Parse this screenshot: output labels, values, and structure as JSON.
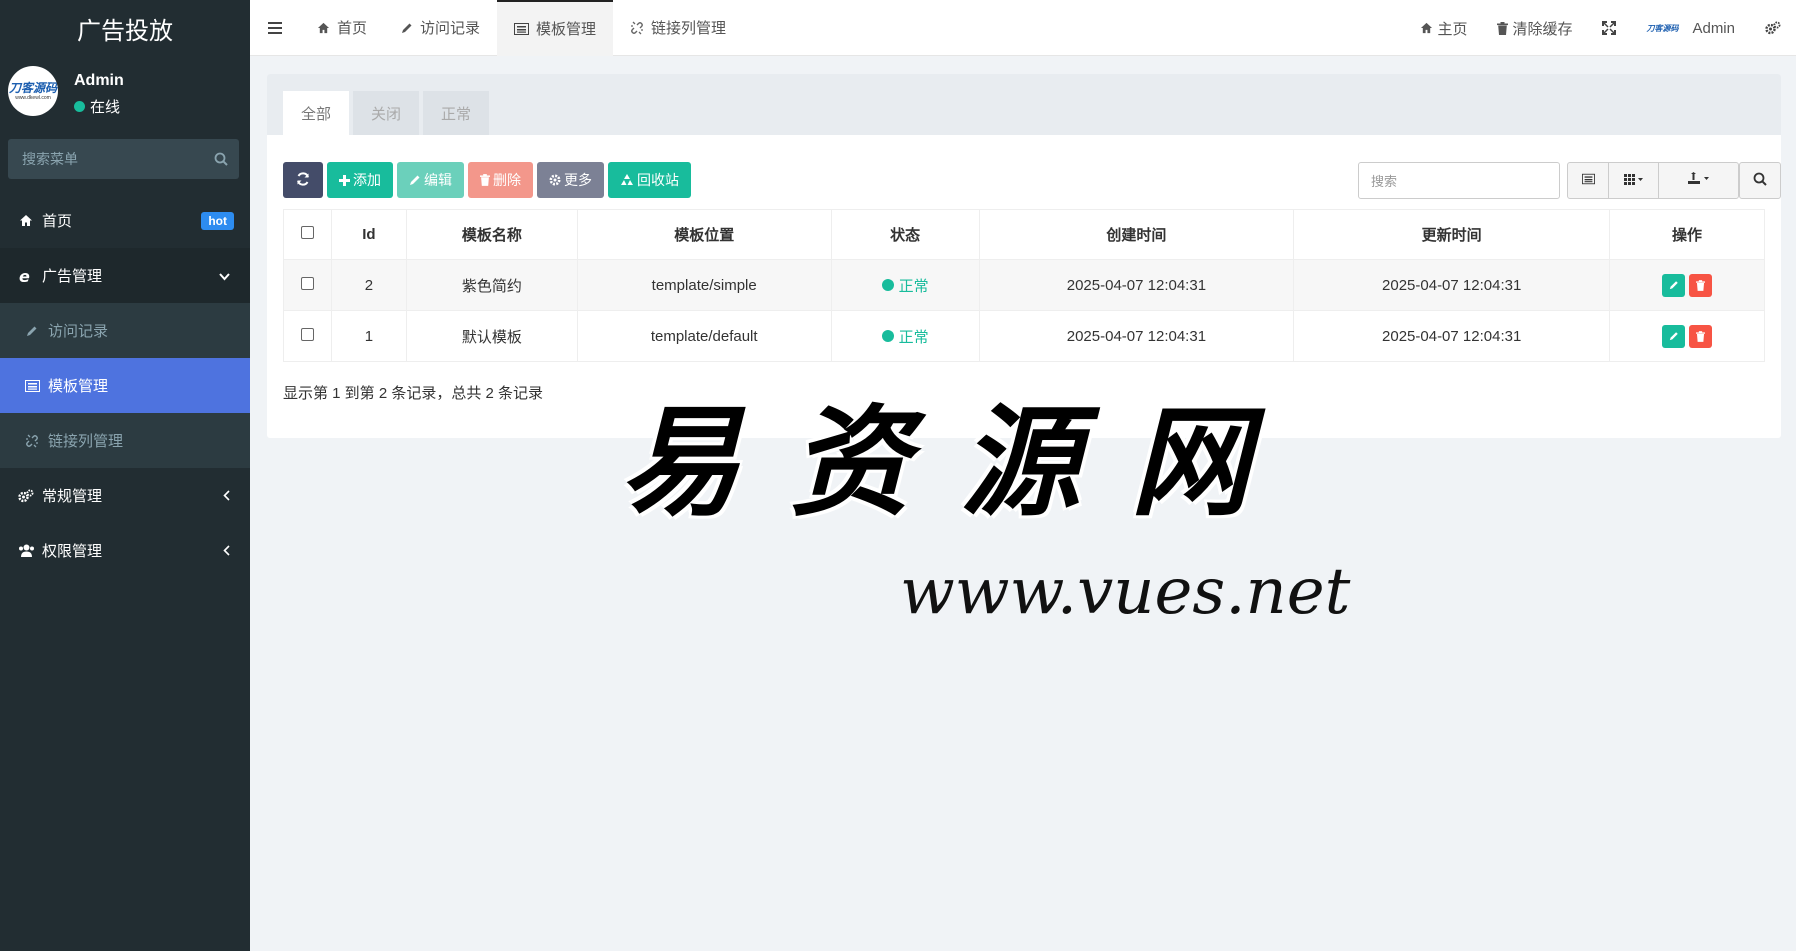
{
  "sidebar": {
    "brand": "广告投放",
    "user": {
      "name": "Admin",
      "status": "在线",
      "avatar_text": "刀客源码",
      "avatar_sub": "www.dkewl.com"
    },
    "search_placeholder": "搜索菜单",
    "menu": {
      "home": {
        "label": "首页",
        "badge": "hot"
      },
      "ad": {
        "label": "广告管理"
      },
      "visits": {
        "label": "访问记录"
      },
      "template": {
        "label": "模板管理"
      },
      "links": {
        "label": "链接列管理"
      },
      "general": {
        "label": "常规管理"
      },
      "perm": {
        "label": "权限管理"
      }
    }
  },
  "topbar": {
    "tabs": [
      "首页",
      "访问记录",
      "模板管理",
      "链接列管理"
    ],
    "right": {
      "home": "主页",
      "clear_cache": "清除缓存",
      "user": "Admin",
      "logo_text": "刀客源码"
    }
  },
  "panel": {
    "tabs": [
      "全部",
      "关闭",
      "正常"
    ],
    "toolbar": {
      "add": "添加",
      "edit": "编辑",
      "delete": "删除",
      "more": "更多",
      "recycle": "回收站"
    },
    "search_placeholder": "搜索",
    "table": {
      "headers": [
        "Id",
        "模板名称",
        "模板位置",
        "状态",
        "创建时间",
        "更新时间",
        "操作"
      ],
      "rows": [
        {
          "id": "2",
          "name": "紫色简约",
          "path": "template/simple",
          "status": "正常",
          "created": "2025-04-07 12:04:31",
          "updated": "2025-04-07 12:04:31"
        },
        {
          "id": "1",
          "name": "默认模板",
          "path": "template/default",
          "status": "正常",
          "created": "2025-04-07 12:04:31",
          "updated": "2025-04-07 12:04:31"
        }
      ]
    },
    "footer": "显示第 1 到第 2 条记录，总共 2 条记录"
  },
  "watermark": {
    "title": "易资源网",
    "url": "www.vues.net"
  },
  "colors": {
    "sidebar_bg": "#222d32",
    "accent": "#18bc9c",
    "active_menu": "#4e73df",
    "danger": "#f75444"
  }
}
